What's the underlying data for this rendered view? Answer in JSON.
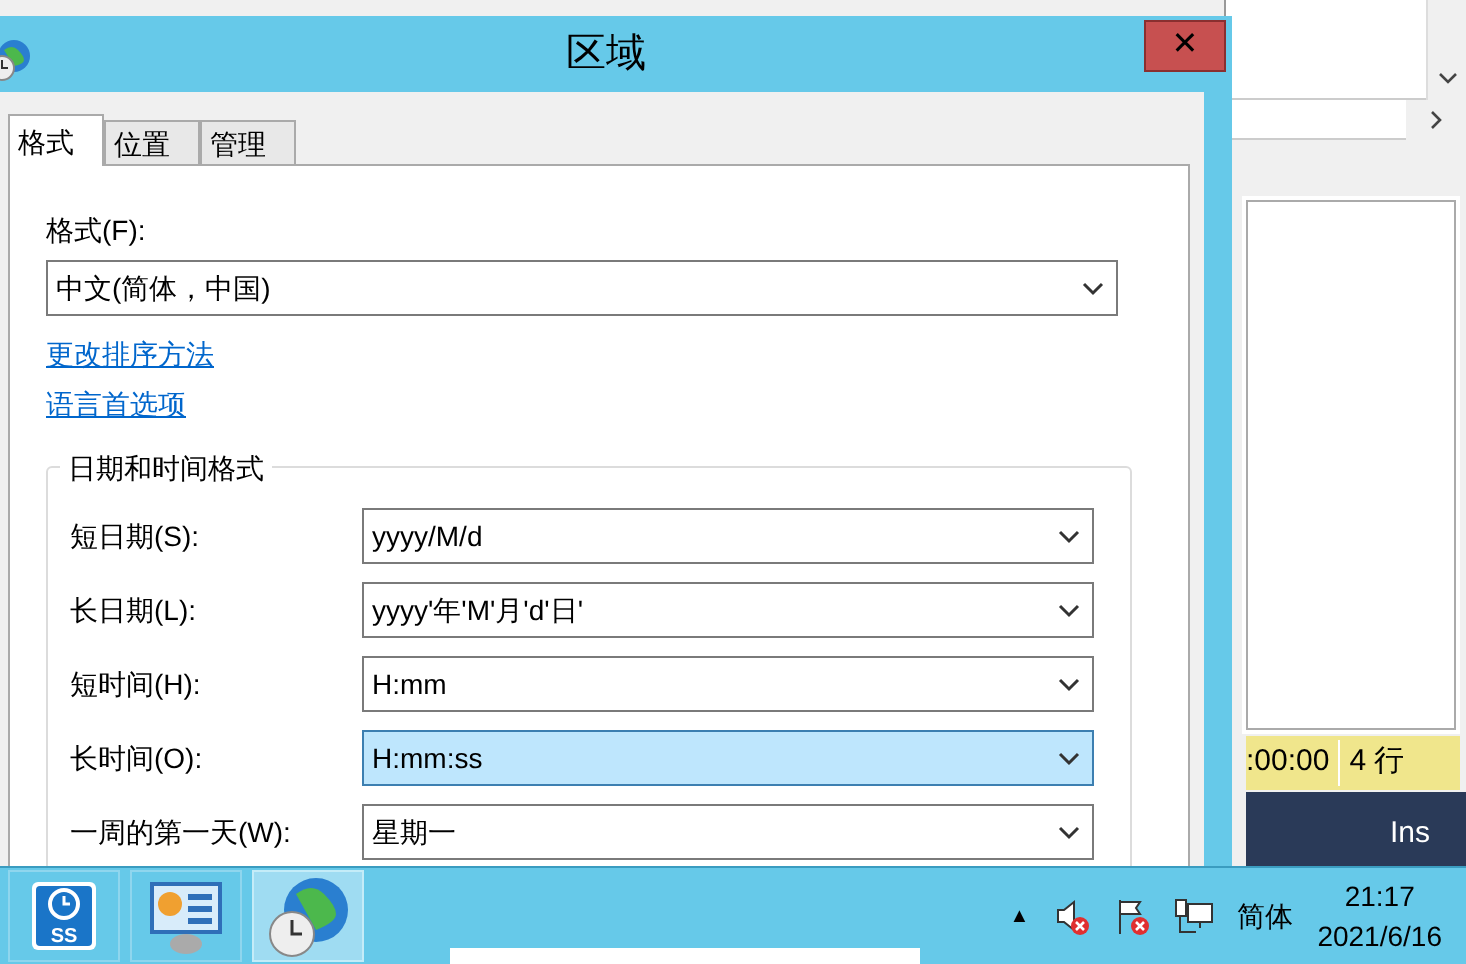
{
  "window": {
    "title": "区域",
    "close": "✕"
  },
  "tabs": [
    {
      "label": "格式",
      "selected": true
    },
    {
      "label": "位置",
      "selected": false
    },
    {
      "label": "管理",
      "selected": false
    }
  ],
  "format": {
    "label": "格式(F):",
    "value": "中文(简体，中国)"
  },
  "links": [
    "更改排序方法",
    "语言首选项"
  ],
  "group": {
    "title": "日期和时间格式",
    "rows": [
      {
        "label": "短日期(S):",
        "value": "yyyy/M/d",
        "focused": false
      },
      {
        "label": "长日期(L):",
        "value": "yyyy'年'M'月'd'日'",
        "focused": false
      },
      {
        "label": "短时间(H):",
        "value": "H:mm",
        "focused": false
      },
      {
        "label": "长时间(O):",
        "value": "H:mm:ss",
        "focused": true
      },
      {
        "label": "一周的第一天(W):",
        "value": "星期一",
        "focused": false
      }
    ]
  },
  "background_window": {
    "status": [
      ":00:00",
      "4 行"
    ],
    "mode": "Ins"
  },
  "taskbar": {
    "buttons": [
      {
        "kind": "clock-app",
        "icon_text": "SS",
        "selected": false
      },
      {
        "kind": "control-panel",
        "selected": false
      },
      {
        "kind": "region",
        "selected": true
      }
    ],
    "tray": {
      "expand": "▲",
      "language": "简体",
      "time": "21:17",
      "date": "2021/6/16"
    }
  }
}
